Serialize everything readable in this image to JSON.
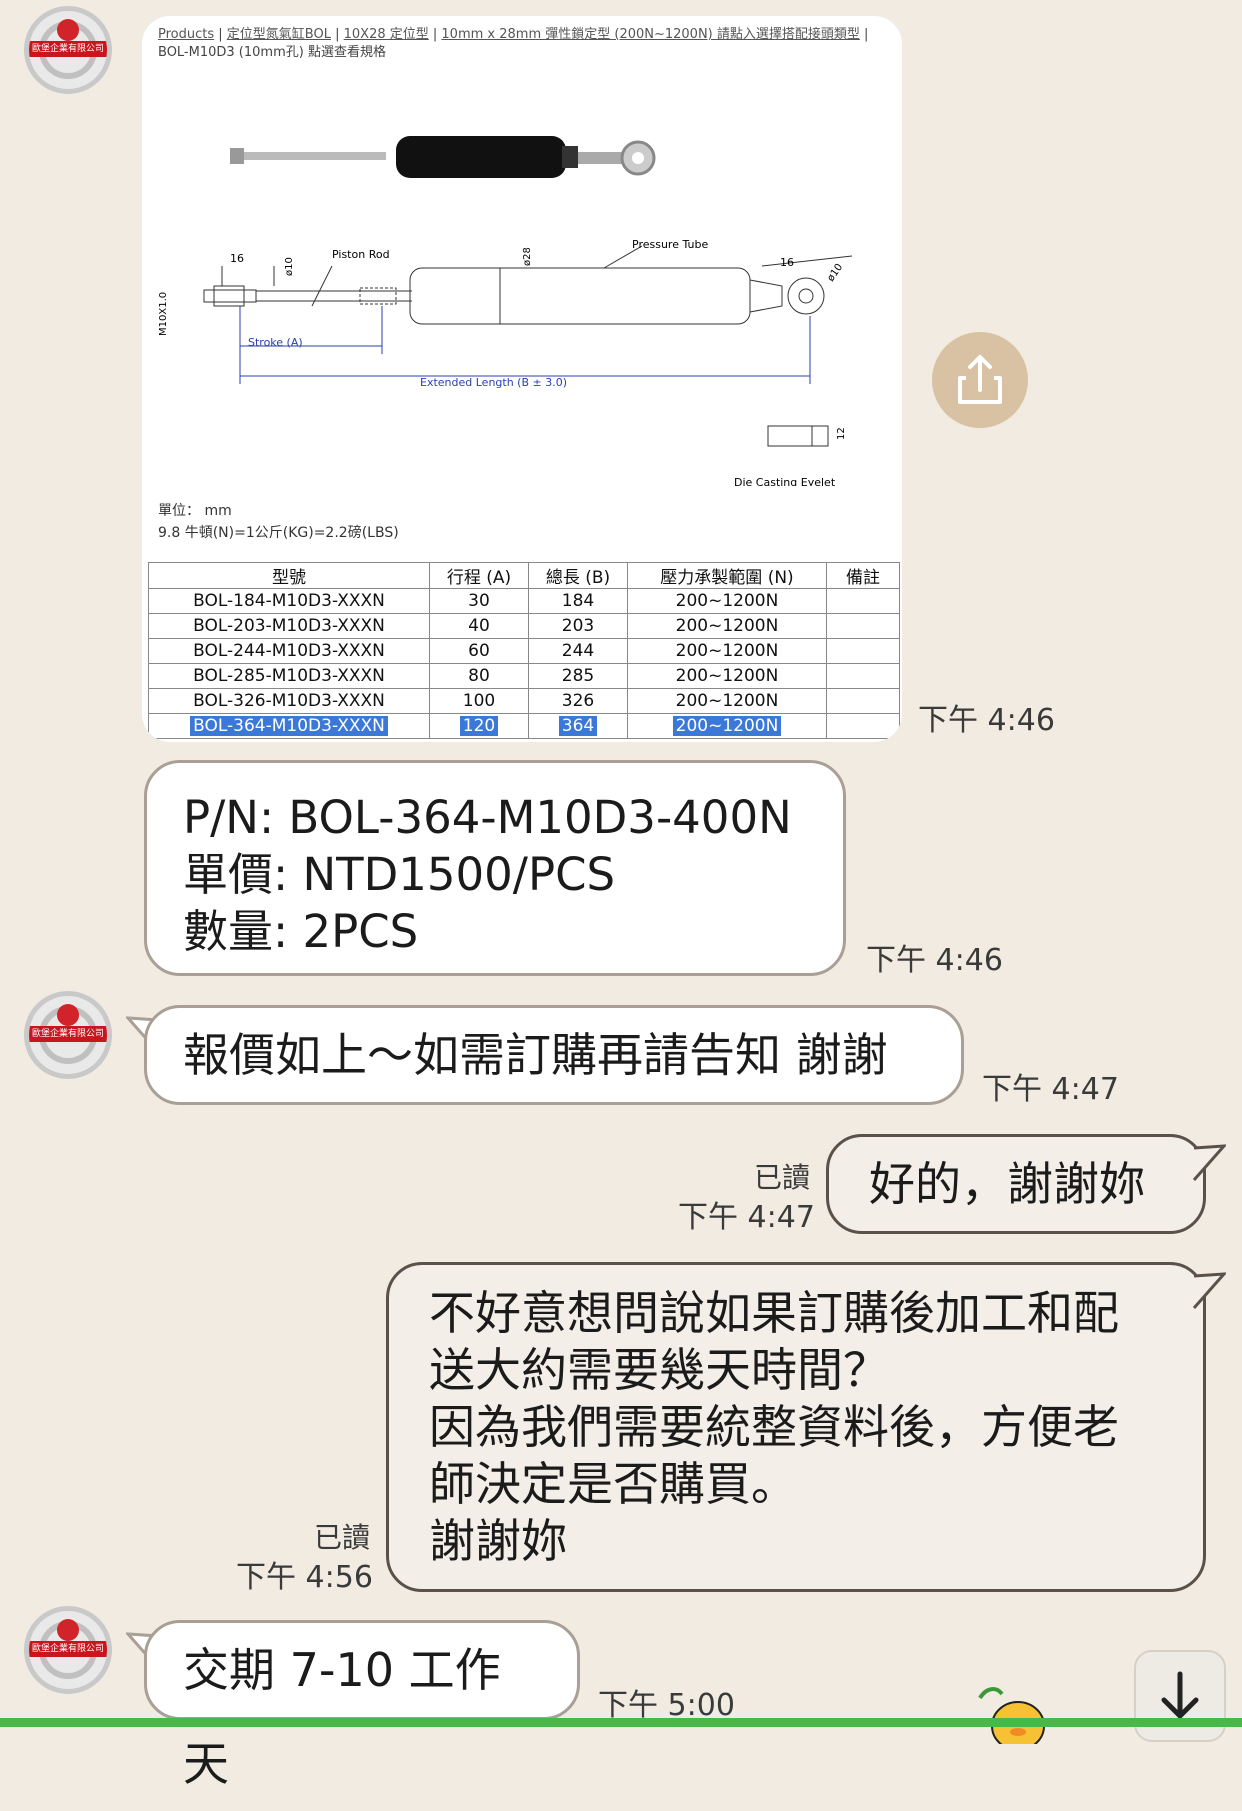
{
  "avatar": {
    "label": "歐堡企業有限公司"
  },
  "product_card": {
    "breadcrumb_products": "Products",
    "breadcrumb_category": "定位型氮氣缸BOL",
    "breadcrumb_type": "10X28 定位型",
    "breadcrumb_series": "10mm x 28mm 彈性鎖定型 (200N~1200N) 請點入選擇搭配接頭類型",
    "breadcrumb_model": "BOL-M10D3 (10mm孔) 點選查看規格",
    "dim_label_16a": "16",
    "dim_label_piston": "Piston Rod",
    "dim_label_d10": "ø10",
    "dim_label_d28": "ø28",
    "dim_label_pressure": "Pressure Tube",
    "dim_label_16b": "16",
    "dim_label_d10b": "ø10",
    "dim_label_m10": "M10X1.0",
    "dim_label_stroke": "Stroke (A)",
    "dim_label_extended": "Extended Length (B ± 3.0)",
    "dim_label_12": "12",
    "dim_label_eyelet": "Die Casting Eyelet",
    "unit_line": "單位： mm",
    "conversion_line": "9.8 牛頓(N)=1公斤(KG)=2.2磅(LBS)",
    "table_headers": [
      "型號",
      "行程 (A)",
      "總長 (B)",
      "壓力承製範圍 (N)",
      "備註"
    ],
    "table_rows": [
      [
        "BOL-184-M10D3-XXXN",
        "30",
        "184",
        "200~1200N",
        ""
      ],
      [
        "BOL-203-M10D3-XXXN",
        "40",
        "203",
        "200~1200N",
        ""
      ],
      [
        "BOL-244-M10D3-XXXN",
        "60",
        "244",
        "200~1200N",
        ""
      ],
      [
        "BOL-285-M10D3-XXXN",
        "80",
        "285",
        "200~1200N",
        ""
      ],
      [
        "BOL-326-M10D3-XXXN",
        "100",
        "326",
        "200~1200N",
        ""
      ],
      [
        "BOL-364-M10D3-XXXN",
        "120",
        "364",
        "200~1200N",
        ""
      ]
    ],
    "time": "下午 4:46"
  },
  "messages": {
    "quote_line1": "P/N: BOL-364-M10D3-400N",
    "quote_line2": "單價: NTD1500/PCS",
    "quote_line3": "數量: 2PCS",
    "quote_time": "下午 4:46",
    "msg2_text": "報價如上～如需訂購再請告知 謝謝",
    "msg2_time": "下午 4:47",
    "msg3_read": "已讀",
    "msg3_time": "下午 4:47",
    "msg3_text": "好的，謝謝妳",
    "msg4_line1": "不好意想問說如果訂購後加工和配",
    "msg4_line2": "送大約需要幾天時間？",
    "msg4_line3": "因為我們需要統整資料後，方便老",
    "msg4_line4": "師決定是否購買。",
    "msg4_line5": "謝謝妳",
    "msg4_read": "已讀",
    "msg4_time": "下午 4:56",
    "msg5_text": "交期 7-10 工作天",
    "msg5_time": "下午 5:00"
  },
  "icons": {
    "share": "share-icon",
    "scroll_down": "arrow-down-icon",
    "sticker": "sticker-icon"
  },
  "colors": {
    "background": "#f1ebe2",
    "share_button": "#d8c2a3",
    "highlight": "#3b78d8",
    "brand_red": "#c9151e"
  }
}
